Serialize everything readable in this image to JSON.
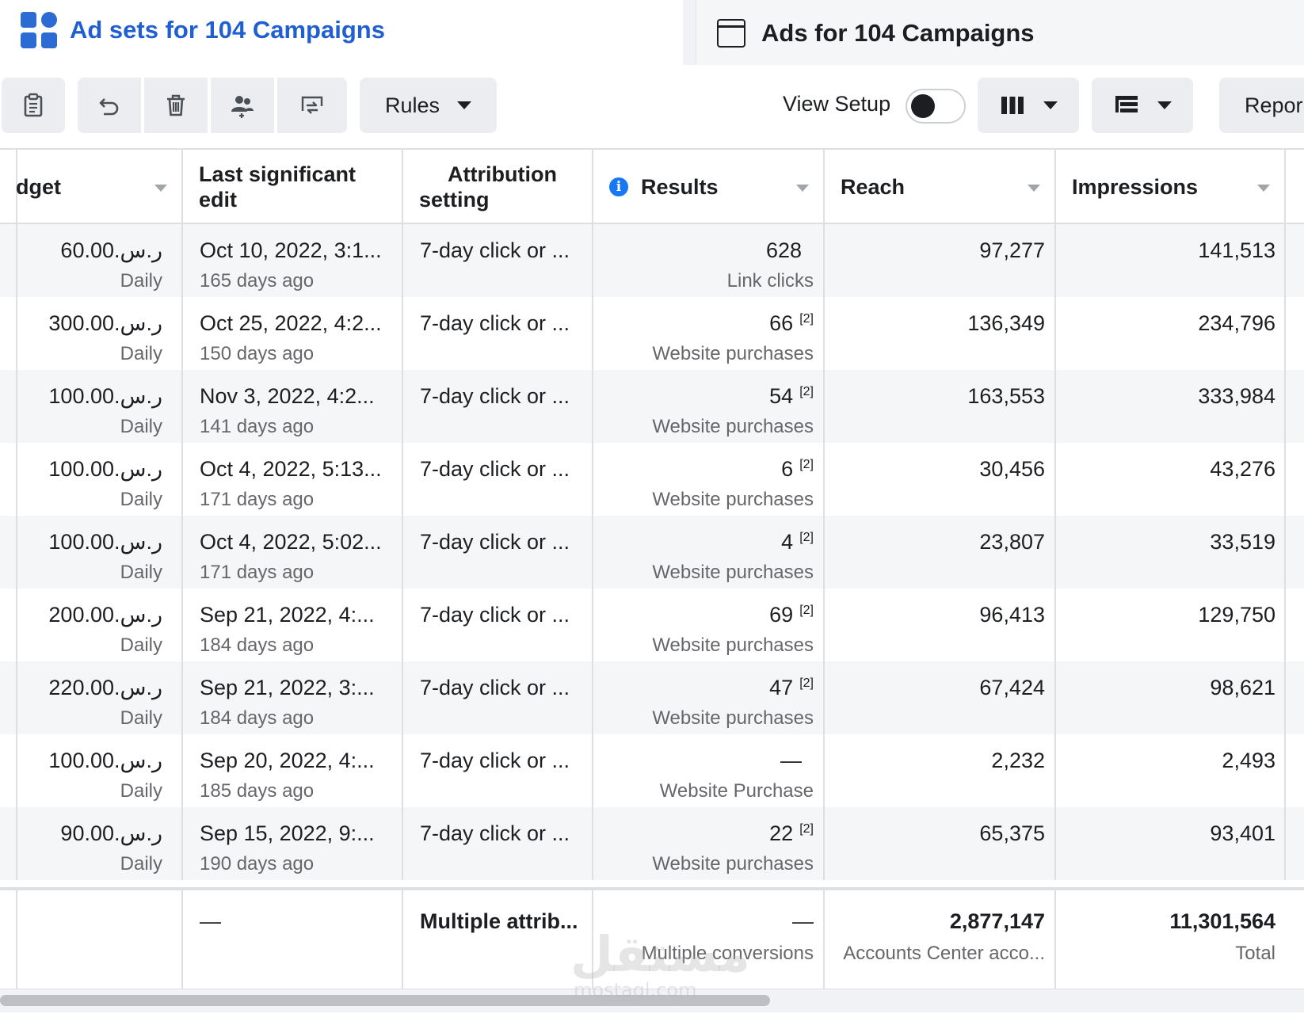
{
  "tabs": {
    "active_label": "Ad sets for 104 Campaigns",
    "inactive_label": "Ads for 104 Campaigns"
  },
  "toolbar": {
    "rules_label": "Rules",
    "view_setup_label": "View Setup",
    "view_setup_on": false,
    "report_label": "Repor"
  },
  "columns": {
    "budget": "dget",
    "last_edit_1": "Last significant",
    "last_edit_2": "edit",
    "attribution_1": "Attribution",
    "attribution_2": "setting",
    "results": "Results",
    "reach": "Reach",
    "impressions": "Impressions"
  },
  "rows": [
    {
      "budget": "60.00.ر.س",
      "budget_sub": "Daily",
      "edit": "Oct 10, 2022, 3:1...",
      "edit_sub": "165 days ago",
      "attribution": "7-day click or ...",
      "result": "628",
      "result_fn": "",
      "result_sub": "Link clicks",
      "reach": "97,277",
      "impressions": "141,513"
    },
    {
      "budget": "300.00.ر.س",
      "budget_sub": "Daily",
      "edit": "Oct 25, 2022, 4:2...",
      "edit_sub": "150 days ago",
      "attribution": "7-day click or ...",
      "result": "66",
      "result_fn": "[2]",
      "result_sub": "Website purchases",
      "reach": "136,349",
      "impressions": "234,796"
    },
    {
      "budget": "100.00.ر.س",
      "budget_sub": "Daily",
      "edit": "Nov 3, 2022, 4:2...",
      "edit_sub": "141 days ago",
      "attribution": "7-day click or ...",
      "result": "54",
      "result_fn": "[2]",
      "result_sub": "Website purchases",
      "reach": "163,553",
      "impressions": "333,984"
    },
    {
      "budget": "100.00.ر.س",
      "budget_sub": "Daily",
      "edit": "Oct 4, 2022, 5:13...",
      "edit_sub": "171 days ago",
      "attribution": "7-day click or ...",
      "result": "6",
      "result_fn": "[2]",
      "result_sub": "Website purchases",
      "reach": "30,456",
      "impressions": "43,276"
    },
    {
      "budget": "100.00.ر.س",
      "budget_sub": "Daily",
      "edit": "Oct 4, 2022, 5:02...",
      "edit_sub": "171 days ago",
      "attribution": "7-day click or ...",
      "result": "4",
      "result_fn": "[2]",
      "result_sub": "Website purchases",
      "reach": "23,807",
      "impressions": "33,519"
    },
    {
      "budget": "200.00.ر.س",
      "budget_sub": "Daily",
      "edit": "Sep 21, 2022, 4:...",
      "edit_sub": "184 days ago",
      "attribution": "7-day click or ...",
      "result": "69",
      "result_fn": "[2]",
      "result_sub": "Website purchases",
      "reach": "96,413",
      "impressions": "129,750"
    },
    {
      "budget": "220.00.ر.س",
      "budget_sub": "Daily",
      "edit": "Sep 21, 2022, 3:...",
      "edit_sub": "184 days ago",
      "attribution": "7-day click or ...",
      "result": "47",
      "result_fn": "[2]",
      "result_sub": "Website purchases",
      "reach": "67,424",
      "impressions": "98,621"
    },
    {
      "budget": "100.00.ر.س",
      "budget_sub": "Daily",
      "edit": "Sep 20, 2022, 4:...",
      "edit_sub": "185 days ago",
      "attribution": "7-day click or ...",
      "result": "—",
      "result_fn": "",
      "result_sub": "Website Purchase",
      "reach": "2,232",
      "impressions": "2,493"
    },
    {
      "budget": "90.00.ر.س",
      "budget_sub": "Daily",
      "edit": "Sep 15, 2022, 9:...",
      "edit_sub": "190 days ago",
      "attribution": "7-day click or ...",
      "result": "22",
      "result_fn": "[2]",
      "result_sub": "Website purchases",
      "reach": "65,375",
      "impressions": "93,401"
    }
  ],
  "totals": {
    "edit": "—",
    "attribution": "Multiple attrib...",
    "result": "—",
    "result_sub": "Multiple conversions",
    "reach": "2,877,147",
    "reach_sub": "Accounts Center acco...",
    "impressions": "11,301,564",
    "impressions_sub": "Total"
  },
  "watermark": {
    "text": "مستقل",
    "sub": "mostaql.com"
  }
}
